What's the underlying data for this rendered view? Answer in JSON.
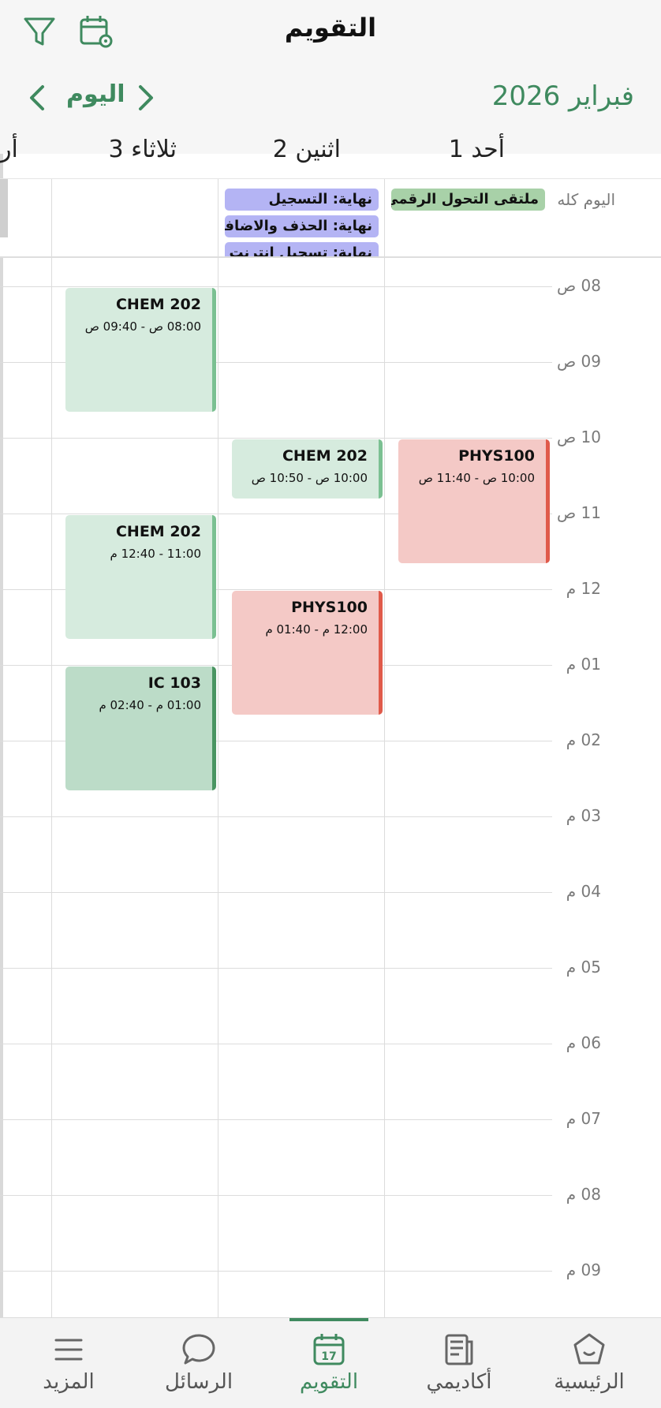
{
  "header": {
    "title": "التقويم",
    "filter_icon": "filter-icon",
    "settings_icon": "calendar-settings-icon"
  },
  "nav": {
    "month_label": "فبراير 2026",
    "today_label": "اليوم"
  },
  "days": [
    {
      "name": "أحد",
      "num": "1"
    },
    {
      "name": "اثنين",
      "num": "2"
    },
    {
      "name": "ثلاثاء",
      "num": "3"
    },
    {
      "name": "أر",
      "num": ""
    }
  ],
  "all_day": {
    "label": "اليوم كله",
    "events": [
      {
        "title": "ملتقى التحول الرقمي",
        "color": "#a8d1a8"
      },
      {
        "title": "نهاية: التسجيل",
        "color": "#b4b4f4"
      },
      {
        "title": "نهاية: الحذف والاضافة",
        "color": "#b4b4f4"
      },
      {
        "title": "نهاية: تسجيل انترنت",
        "color": "#b4b4f4"
      }
    ]
  },
  "time_labels": [
    "08 ص",
    "09 ص",
    "10 ص",
    "11 ص",
    "12 م",
    "01 م",
    "02 م",
    "03 م",
    "04 م",
    "05 م",
    "06 م",
    "07 م",
    "08 م",
    "09 م"
  ],
  "events": [
    {
      "code": "CHEM 202",
      "time": "08:00 ص - 09:40 ص",
      "day": "ثلاثاء"
    },
    {
      "code": "CHEM 202",
      "time": "10:00 ص - 10:50 ص",
      "day": "اثنين"
    },
    {
      "code": "PHYS100",
      "time": "10:00 ص - 11:40 ص",
      "day": "أحد"
    },
    {
      "code": "CHEM 202",
      "time": "11:00 - 12:40 م",
      "day": "ثلاثاء"
    },
    {
      "code": "PHYS100",
      "time": "12:00 م - 01:40 م",
      "day": "اثنين"
    },
    {
      "code": "IC 103",
      "time": "01:00 م - 02:40 م",
      "day": "ثلاثاء"
    }
  ],
  "tabs": [
    {
      "label": "الرئيسية",
      "icon": "home-icon"
    },
    {
      "label": "أكاديمي",
      "icon": "academic-icon"
    },
    {
      "label": "التقويم",
      "icon": "calendar-icon",
      "active": true,
      "badge": "17"
    },
    {
      "label": "الرسائل",
      "icon": "chat-icon"
    },
    {
      "label": "المزيد",
      "icon": "menu-icon"
    }
  ],
  "colors": {
    "accent": "#3f8a5f",
    "course_green": "#d6ebde",
    "course_red": "#f4c9c6",
    "deadline_blue": "#b4b4f4"
  }
}
